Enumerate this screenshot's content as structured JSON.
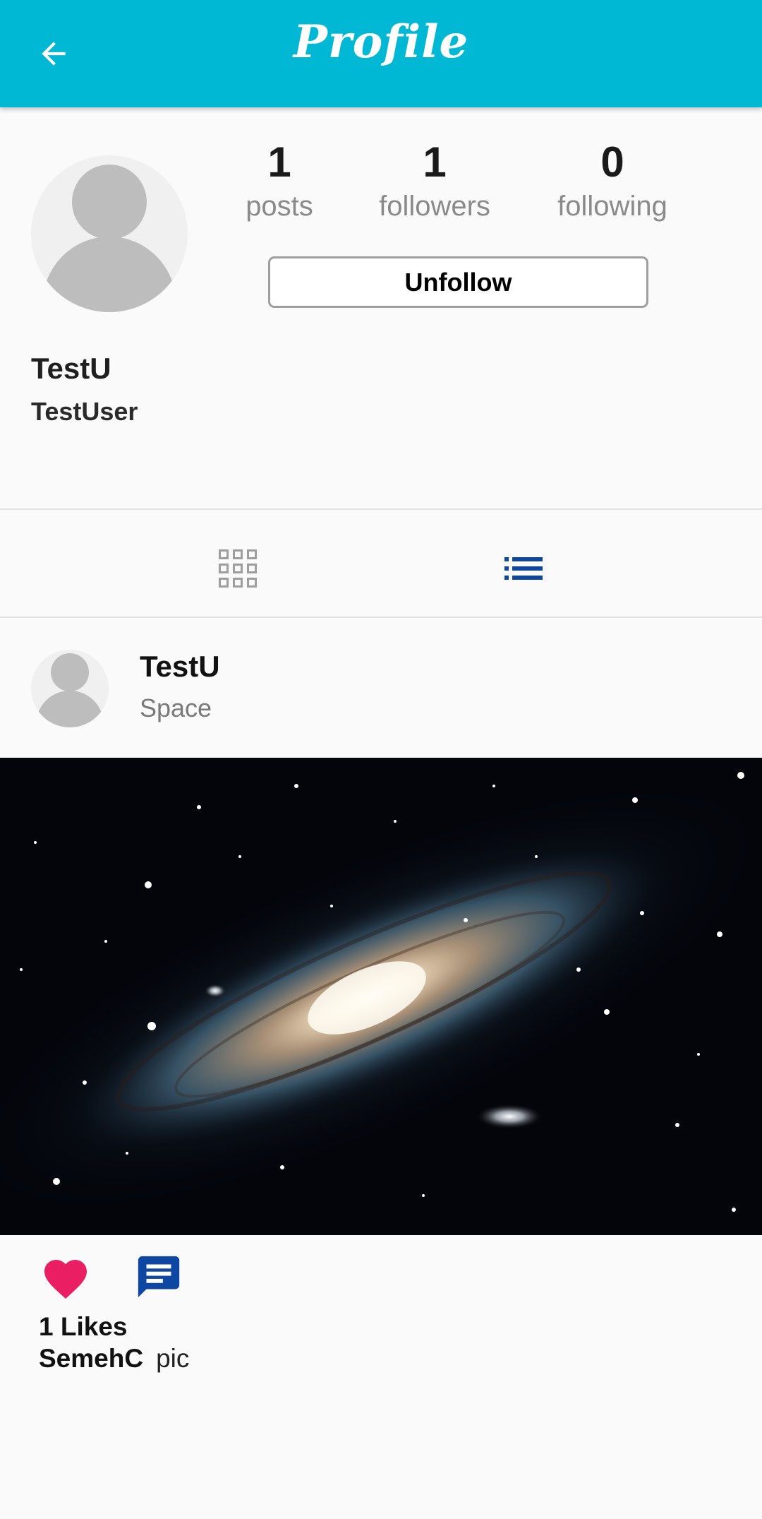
{
  "app_bar": {
    "title": "Profile",
    "back_icon": "arrow-left-icon",
    "background": "#00b8d4"
  },
  "profile": {
    "avatar_icon": "default-avatar-icon",
    "stats": [
      {
        "value": "1",
        "label": "posts"
      },
      {
        "value": "1",
        "label": "followers"
      },
      {
        "value": "0",
        "label": "following"
      }
    ],
    "action_button": "Unfollow",
    "name": "TestU",
    "username": "TestUser"
  },
  "view_tabs": {
    "grid_icon": "grid-view-icon",
    "list_icon": "list-view-icon",
    "active": "list",
    "active_color": "#0d47a1",
    "inactive_color": "#9e9e9e"
  },
  "post": {
    "author": "TestU",
    "subtitle": "Space",
    "image_icon": "galaxy-image",
    "like_icon": "heart-icon",
    "like_color": "#e91e63",
    "comment_icon": "comment-icon",
    "comment_color": "#0d47a1",
    "likes": "1 Likes",
    "caption_author": "SemehC",
    "caption_text": "pic"
  }
}
